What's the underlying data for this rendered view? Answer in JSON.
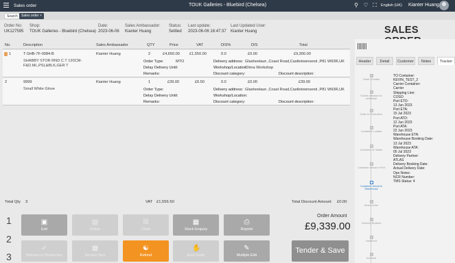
{
  "topbar": {
    "app_title": "Sales order",
    "center_title": "TOUK Galleries - Bluebird (Chelsea)",
    "language": "English (UK)",
    "user_name": "Kianter Huang"
  },
  "tabs": {
    "search": "Search",
    "sales_order": "Sales order"
  },
  "header": {
    "order_no_label": "Order No:",
    "order_no": "UK127595",
    "shop_label": "Shop:",
    "shop": "TOUK Galleries - Bluebird (Chelsea)",
    "date_label": "Date:",
    "date": "2023-06-06",
    "ambassador_label": "Sales Ambassador:",
    "ambassador": "Kianter Huang",
    "status_label": "Status:",
    "status": "Settled",
    "last_update_label": "Last update:",
    "last_update": "2023-06-06 16:47:37",
    "last_user_label": "Last Updated User:",
    "last_user": "Kianter Huang",
    "page_title": "SALES ORDER"
  },
  "table": {
    "columns": [
      "No.",
      "Description",
      "Sales Ambassador",
      "QTY",
      "Price",
      "VAT",
      "DIS%",
      "DIS",
      "Total"
    ],
    "rows": [
      {
        "no": "1",
        "sku": "T-SHB-7F-0084-B",
        "desc": "SHABBY STOR RND C.T 120CM-F&D.ML,PSL&BLK,GER T",
        "ambassador": "Kianter Huang",
        "qty": "2",
        "price": "£4,650.00",
        "vat": "£1,550.00",
        "dis_pct": "0.0",
        "dis": "£0.00",
        "total": "£9,300.00",
        "order_type_label": "Order Type:",
        "order_type": "MTO",
        "delay_label": "Delay Delivery Until:",
        "remarks_label": "Remarks:",
        "delivery_label": "Delivery address:",
        "delivery": "Glasheelaun ,Coast Road,Castletownsend ,P81 W93R,UK",
        "workshop_label": "Workshop/Location:",
        "workshop": "China Workshop",
        "discount_cat_label": "Discount category:",
        "discount_desc_label": "Discount description:"
      },
      {
        "no": "2",
        "sku": "9999",
        "desc": "Small White Glove",
        "ambassador": "Kianter Huang",
        "qty": "1",
        "price": "£39.00",
        "vat": "£6.50",
        "dis_pct": "0.0",
        "dis": "£0.00",
        "total": "£39.00",
        "order_type_label": "Order Type:",
        "order_type": "",
        "delay_label": "Delay Delivery Until:",
        "remarks_label": "Remarks:",
        "delivery_label": "Delivery address:",
        "delivery": "Glasheelaun ,Coast Road,Castletownsend ,P81 W93R,UK",
        "workshop_label": "Workshop/Location:",
        "workshop": "",
        "discount_cat_label": "Discount category:",
        "discount_desc_label": "Discount description:"
      }
    ]
  },
  "totals": {
    "qty_label": "Total Qty",
    "qty": "3",
    "vat_label": "VAT",
    "vat": "£1,556.50",
    "discount_label": "Total Discount Amount",
    "discount": "£0.00"
  },
  "side_tabs": [
    "Header",
    "Detail",
    "Customer",
    "Notes",
    "Tracker"
  ],
  "tracker_steps": [
    "Order Created",
    "Orders released to workshop",
    "Order in Production",
    "Container Loaded",
    "Container on Water",
    "Container arrival in Port",
    "Container arrival to Warehouse",
    "Stock Order",
    "Delivery Booked",
    "Delivered",
    "Invoiced"
  ],
  "tracker_info": [
    "TO Container:",
    "KEVIN_TEST_2",
    "Carrier Container:",
    "Carrier",
    "Shipping Line:",
    "COSO",
    "Port ETD:",
    "13 Jun 2023",
    "Port ETA:",
    "15 Jul 2023",
    "Port ATD:",
    "12 Jun 2023",
    "Port ATA:",
    "22 Jun 2023",
    "Warehouse ETA:",
    "Warehouse Booking Date:",
    "13 Jul 2023",
    "Warehouse ATA:",
    "05 Jul 2023",
    "Delivery Partner:",
    "ATLAS",
    "Delivery Booking Date:",
    "Actual Delivery Date:",
    "Ops Notes:",
    "NCR Number:",
    "TMS Status: 4"
  ],
  "buttons": {
    "exit": "Exit",
    "delete": "Delete",
    "close": "Close",
    "stock_enquiry": "Stock Enquiry",
    "reprint": "Reprint",
    "release": "Release to Production",
    "service_item": "Service Item",
    "refund": "Refund",
    "hold_order": "Hold Order",
    "multiple_edit": "Multiple Edit",
    "tender_save": "Tender & Save"
  },
  "row_numbers": [
    "1",
    "2",
    "3"
  ],
  "order_amount_label": "Order Amount",
  "order_amount": "£9,339.00",
  "colors": {
    "topbar": "#2f3a48",
    "refund": "#f39322",
    "tracker_active": "#2b7ac3"
  },
  "icons": [
    "menu-icon",
    "search-icon",
    "bell-icon",
    "fullscreen-icon",
    "globe-icon",
    "avatar-icon"
  ]
}
